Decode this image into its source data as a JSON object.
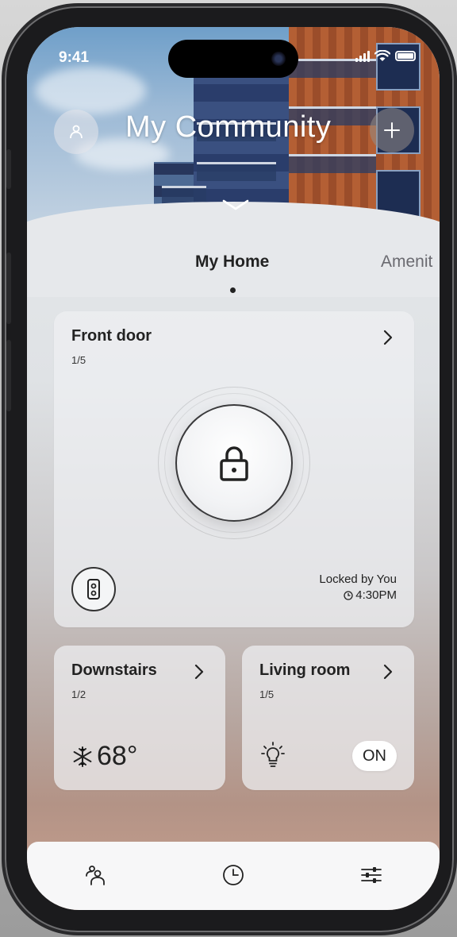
{
  "status_bar": {
    "time": "9:41"
  },
  "header": {
    "title": "My Community",
    "profile_icon": "person-icon",
    "add_icon": "plus-icon",
    "expand_icon": "chevron-down-icon"
  },
  "tabs": [
    {
      "label": "My Home",
      "active": true
    },
    {
      "label": "Amenit",
      "active": false
    }
  ],
  "front_door": {
    "title": "Front door",
    "count": "1/5",
    "lock_icon": "padlock-icon",
    "status": "Locked by You",
    "time": "4:30PM",
    "time_icon": "clock-icon",
    "camera_icon": "doorbell-camera-icon"
  },
  "downstairs": {
    "title": "Downstairs",
    "count": "1/2",
    "temperature": "68°",
    "mode_icon": "snowflake-icon"
  },
  "living_room": {
    "title": "Living room",
    "count": "1/5",
    "toggle_label": "ON",
    "light_icon": "lightbulb-icon"
  },
  "bottom_nav": [
    {
      "icon": "people-icon"
    },
    {
      "icon": "clock-icon"
    },
    {
      "icon": "sliders-icon"
    }
  ],
  "colors": {
    "text": "#222222",
    "card_bg": "#eef0f3",
    "accent_white": "#ffffff"
  }
}
